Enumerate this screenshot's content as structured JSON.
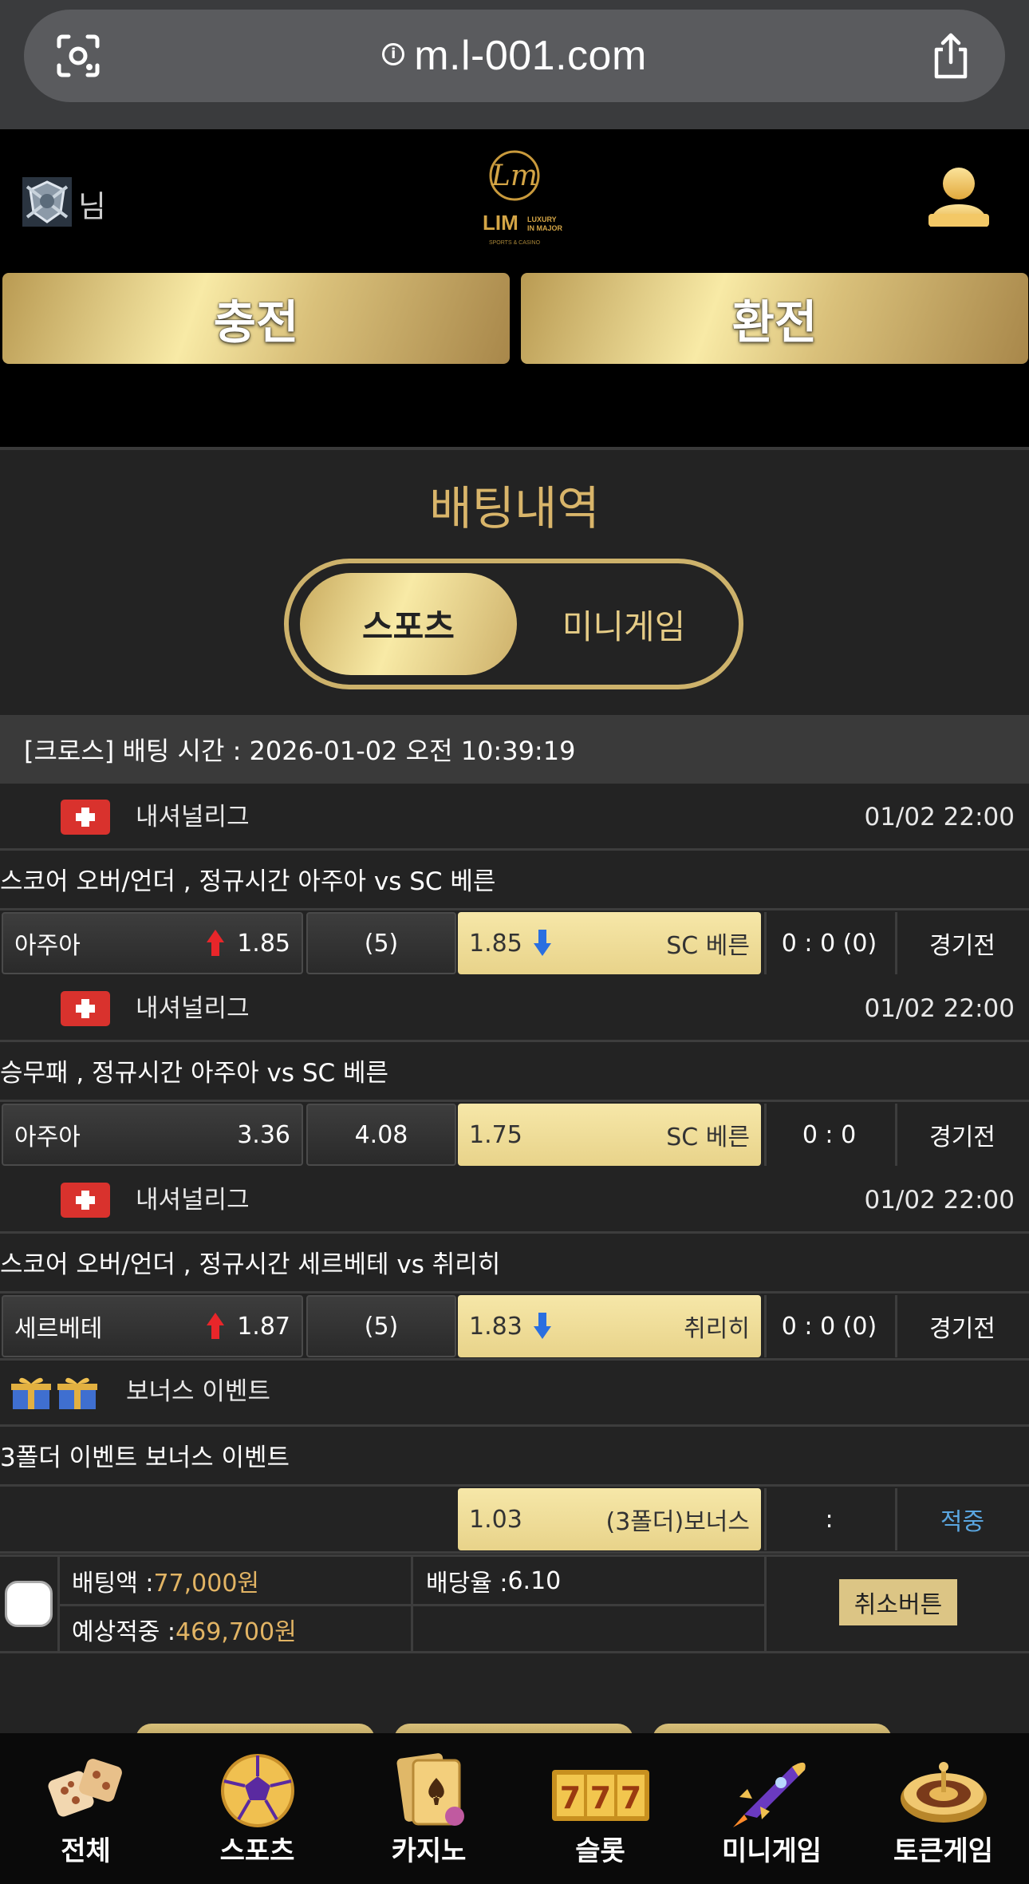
{
  "browser": {
    "url": "m.l-001.com"
  },
  "header": {
    "username": "님",
    "logo_main": "LIM",
    "logo_side": "LUXURY IN MAJOR",
    "logo_sub": "SPORTS & CASINO",
    "deposit_label": "충전",
    "withdraw_label": "환전"
  },
  "page": {
    "title": "배팅내역",
    "tabs": [
      {
        "label": "스포츠",
        "active": true
      },
      {
        "label": "미니게임",
        "active": false
      }
    ]
  },
  "bet_slip": {
    "header": "[크로스] 배팅 시간 : 2026-01-02 오전 10:39:19",
    "games": [
      {
        "league": "내셔널리그",
        "time": "01/02 22:00",
        "market": "스코어 오버/언더 , 정규시간 아주아  vs  SC 베른",
        "home": "아주아",
        "home_odds": "1.85",
        "line": "(5)",
        "away_odds": "1.85",
        "away": "SC 베른",
        "score": "0 : 0 (0)",
        "status": "경기전",
        "arrows": true
      },
      {
        "league": "내셔널리그",
        "time": "01/02 22:00",
        "market": "승무패 , 정규시간 아주아  vs  SC 베른",
        "home": "아주아",
        "home_odds": "3.36",
        "line": "4.08",
        "away_odds": "1.75",
        "away": "SC 베른",
        "score": "0 : 0",
        "status": "경기전",
        "arrows": false
      },
      {
        "league": "내셔널리그",
        "time": "01/02 22:00",
        "market": "스코어 오버/언더 , 정규시간 세르베테  vs  취리히",
        "home": "세르베테",
        "home_odds": "1.87",
        "line": "(5)",
        "away_odds": "1.83",
        "away": "취리히",
        "score": "0 : 0 (0)",
        "status": "경기전",
        "arrows": true
      }
    ],
    "bonus": {
      "title": "보너스 이벤트",
      "market": "3폴더 이벤트 보너스 이벤트",
      "odds": "1.03",
      "label": "(3폴더)보너스",
      "score": ":",
      "status": "적중",
      "status_color": "#5aa6e0"
    },
    "summary": {
      "bet_amount_label": "배팅액 : ",
      "bet_amount": "77,000원",
      "odds_label": "배당율 : ",
      "odds": "6.10",
      "expected_label": "예상적중 : ",
      "expected": "469,700원",
      "cancel_label": "취소버튼"
    }
  },
  "tabbar": [
    {
      "label": "전체",
      "icon": "dice-icon"
    },
    {
      "label": "스포츠",
      "icon": "soccer-ball-icon"
    },
    {
      "label": "카지노",
      "icon": "cards-icon"
    },
    {
      "label": "슬롯",
      "icon": "slot-777-icon"
    },
    {
      "label": "미니게임",
      "icon": "rocket-icon"
    },
    {
      "label": "토큰게임",
      "icon": "roulette-icon"
    }
  ],
  "colors": {
    "gold": "#d9b56a",
    "accent_blue": "#5aa6e0",
    "up_red": "#e8262a",
    "down_blue": "#2a6fe0"
  }
}
